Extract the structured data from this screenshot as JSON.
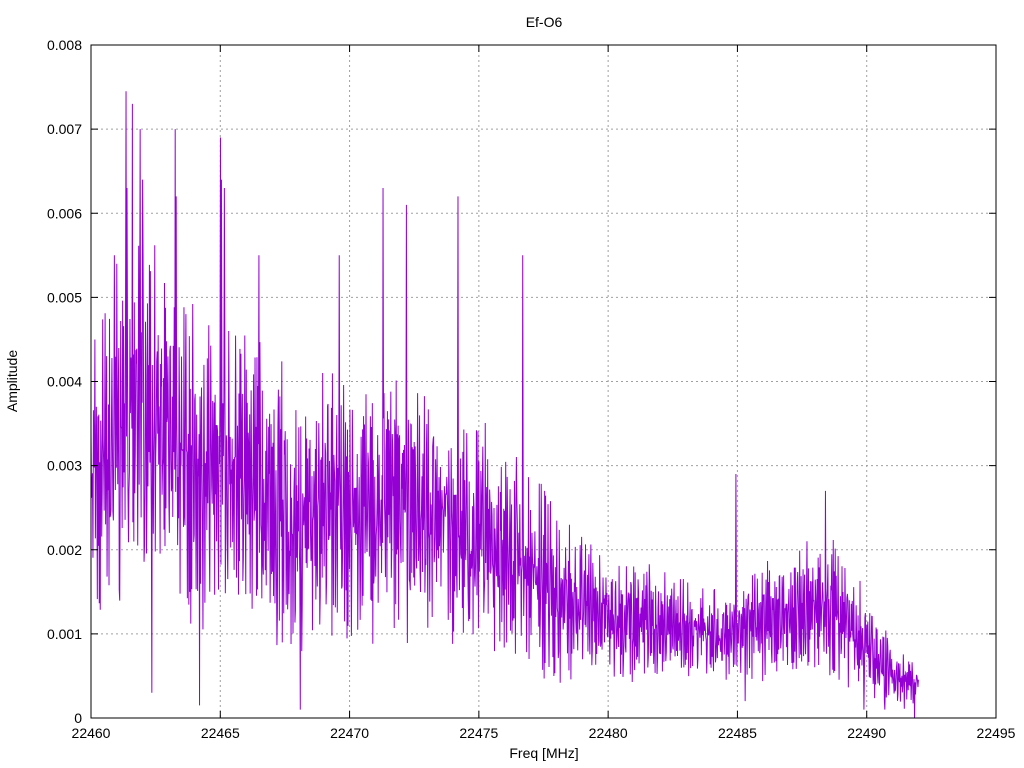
{
  "chart_data": {
    "type": "line",
    "title": "Ef-O6",
    "xlabel": "Freq [MHz]",
    "ylabel": "Amplitude",
    "xlim": [
      22460,
      22495
    ],
    "ylim": [
      0,
      0.008
    ],
    "xticks": [
      22460,
      22465,
      22470,
      22475,
      22480,
      22485,
      22490,
      22495
    ],
    "yticks": [
      0,
      0.001,
      0.002,
      0.003,
      0.004,
      0.005,
      0.006,
      0.007,
      0.008
    ],
    "xtick_labels": [
      "22460",
      "22465",
      "22470",
      "22475",
      "22480",
      "22485",
      "22490",
      "22495"
    ],
    "ytick_labels": [
      "0",
      "0.001",
      "0.002",
      "0.003",
      "0.004",
      "0.005",
      "0.006",
      "0.007",
      "0.008"
    ],
    "grid": true,
    "series": [
      {
        "color": "#9400d3",
        "x_range": [
          22460.0,
          22492.0
        ],
        "envelope_breakpoints": {
          "freq": [
            22460,
            22461,
            22462,
            22463,
            22464,
            22465,
            22466,
            22467,
            22468,
            22469,
            22470,
            22471,
            22472,
            22473,
            22474,
            22475,
            22476,
            22477,
            22478,
            22479,
            22480,
            22481,
            22482,
            22483,
            22484,
            22485,
            22486,
            22487,
            22488,
            22489,
            22490,
            22491,
            22492
          ],
          "upper": [
            0.0045,
            0.0052,
            0.006,
            0.0055,
            0.005,
            0.005,
            0.0048,
            0.0045,
            0.004,
            0.0042,
            0.004,
            0.004,
            0.0042,
            0.004,
            0.0038,
            0.0036,
            0.0034,
            0.003,
            0.0026,
            0.0022,
            0.002,
            0.0019,
            0.0018,
            0.0017,
            0.0016,
            0.0016,
            0.0019,
            0.002,
            0.0022,
            0.0021,
            0.0015,
            0.0009,
            0.0007
          ],
          "lower": [
            0.0008,
            0.0012,
            0.0012,
            0.0012,
            0.001,
            0.001,
            0.001,
            0.0008,
            0.0006,
            0.0008,
            0.0008,
            0.0008,
            0.0008,
            0.0008,
            0.0007,
            0.0006,
            0.0006,
            0.0005,
            0.0004,
            0.0004,
            0.0004,
            0.0004,
            0.0004,
            0.0004,
            0.0004,
            0.0004,
            0.0004,
            0.0004,
            0.0004,
            0.0004,
            0.0002,
            0.0001,
            0.0001
          ]
        },
        "peaks": [
          {
            "x": 22460.15,
            "y": 0.0045
          },
          {
            "x": 22460.9,
            "y": 0.0055
          },
          {
            "x": 22461.0,
            "y": 0.0054
          },
          {
            "x": 22461.35,
            "y": 0.00745
          },
          {
            "x": 22461.4,
            "y": 0.0063
          },
          {
            "x": 22461.6,
            "y": 0.0073
          },
          {
            "x": 22461.9,
            "y": 0.007
          },
          {
            "x": 22462.0,
            "y": 0.0064
          },
          {
            "x": 22463.25,
            "y": 0.007
          },
          {
            "x": 22463.3,
            "y": 0.0062
          },
          {
            "x": 22465.0,
            "y": 0.0069
          },
          {
            "x": 22465.05,
            "y": 0.0064
          },
          {
            "x": 22465.15,
            "y": 0.0063
          },
          {
            "x": 22466.5,
            "y": 0.0055
          },
          {
            "x": 22469.6,
            "y": 0.0055
          },
          {
            "x": 22471.3,
            "y": 0.0063
          },
          {
            "x": 22472.2,
            "y": 0.0061
          },
          {
            "x": 22474.2,
            "y": 0.0062
          },
          {
            "x": 22476.7,
            "y": 0.0055
          },
          {
            "x": 22484.95,
            "y": 0.0029
          },
          {
            "x": 22488.4,
            "y": 0.0027
          }
        ],
        "dips": [
          {
            "x": 22462.35,
            "y": 0.0003
          },
          {
            "x": 22464.2,
            "y": 0.00015
          },
          {
            "x": 22468.1,
            "y": 0.0001
          },
          {
            "x": 22477.9,
            "y": 0.0005
          },
          {
            "x": 22485.3,
            "y": 0.0002
          },
          {
            "x": 22489.9,
            "y": 0.0001
          },
          {
            "x": 22490.7,
            "y": 0.0001
          },
          {
            "x": 22491.85,
            "y": 0.0
          }
        ]
      }
    ]
  }
}
